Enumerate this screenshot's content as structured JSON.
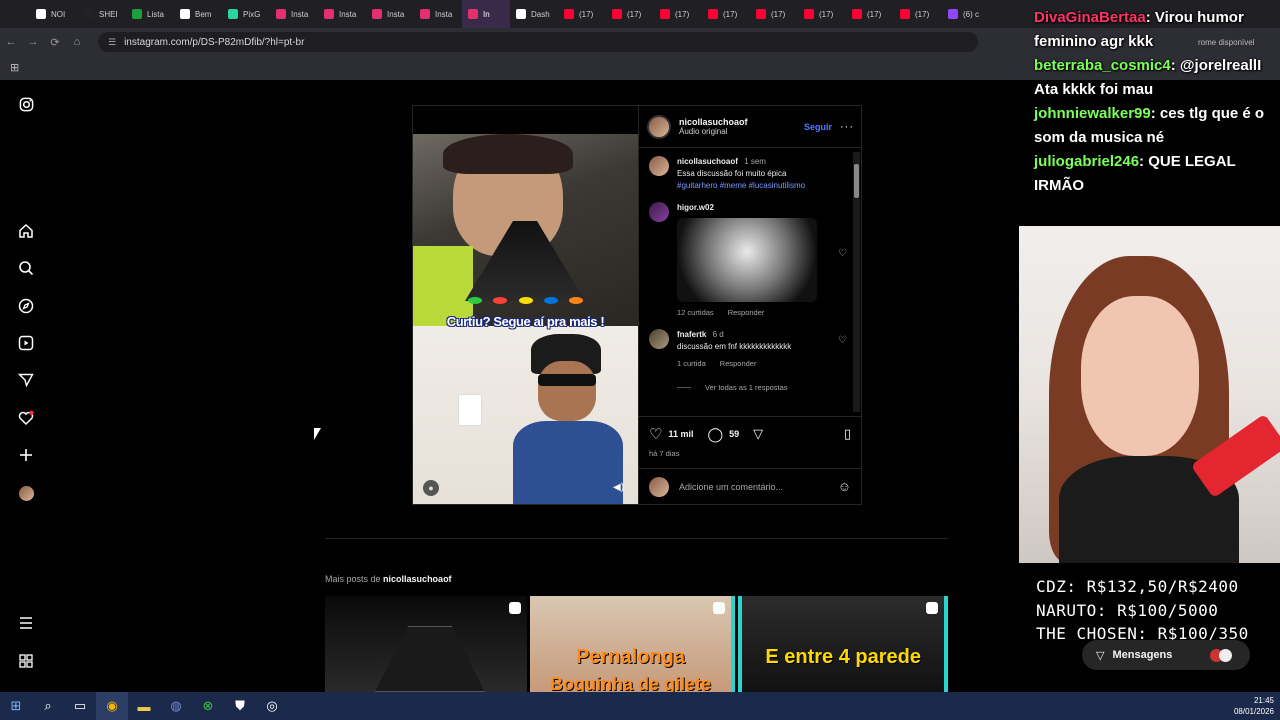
{
  "browser": {
    "tabs": [
      {
        "label": "NOI",
        "color": "#ffffff"
      },
      {
        "label": "SHEI",
        "color": "#222222"
      },
      {
        "label": "Lista",
        "color": "#1e9e3a"
      },
      {
        "label": "Bem",
        "color": "#ffffff"
      },
      {
        "label": "PixG",
        "color": "#2ad49a"
      },
      {
        "label": "Insta",
        "color": "#e1306c"
      },
      {
        "label": "Insta",
        "color": "#e1306c"
      },
      {
        "label": "Insta",
        "color": "#e1306c"
      },
      {
        "label": "Insta",
        "color": "#e1306c"
      },
      {
        "label": "In",
        "color": "#e1306c",
        "active": true
      },
      {
        "label": "Dash",
        "color": "#ffffff"
      },
      {
        "label": "(17)",
        "color": "#ff0033"
      },
      {
        "label": "(17)",
        "color": "#ff0033"
      },
      {
        "label": "(17)",
        "color": "#ff0033"
      },
      {
        "label": "(17)",
        "color": "#ff0033"
      },
      {
        "label": "(17)",
        "color": "#ff0033"
      },
      {
        "label": "(17)",
        "color": "#ff0033"
      },
      {
        "label": "(17)",
        "color": "#ff0033"
      },
      {
        "label": "(17)",
        "color": "#ff0033"
      },
      {
        "label": "(6) c",
        "color": "#9146ff"
      }
    ],
    "url": "instagram.com/p/DS-P82mDfib/?hl=pt-br",
    "update_text": "rome disponível"
  },
  "post": {
    "author": "nicollasuchoaof",
    "audio": "Áudio original",
    "follow_label": "Seguir",
    "overlay_caption": "Curtiu? Segue aí pra mais !",
    "caption": {
      "user": "nicollasuchoaof",
      "time": "1 sem",
      "text": "Essa discussão foi muito épica",
      "tags": "#guitarhero #meme #lucasinutilismo"
    },
    "comments": [
      {
        "user": "higor.w02",
        "likes": "12 curtidas",
        "reply": "Responder"
      },
      {
        "user": "fnafertk",
        "time": "6 d",
        "text": "discussão em fnf kkkkkkkkkkkkk",
        "likes": "1 curtida",
        "reply": "Responder",
        "replies": "Ver todas as 1 respostas"
      }
    ],
    "like_count": "11 mil",
    "comment_count": "59",
    "posted_ago": "há 7 dias",
    "add_comment_placeholder": "Adicione um comentário..."
  },
  "more_posts": {
    "label": "Mais posts de",
    "user": "nicollasuchoaof",
    "thumbs": [
      {
        "caption": ""
      },
      {
        "caption": "Pernalonga",
        "caption2": "Boquinha de gilete"
      },
      {
        "caption": "E entre 4 parede"
      }
    ]
  },
  "stream": {
    "chat": [
      {
        "name": "DivaGinaBertaa",
        "msg": ": Virou humor feminino agr kkk",
        "pink": true
      },
      {
        "name": "beterraba_cosmic4",
        "msg": ": @jorelreallI Ata kkkk foi mau"
      },
      {
        "name": "johnniewalker99",
        "msg": ": ces tlg que é o som da musica né"
      },
      {
        "name": "juliogabriel246",
        "msg": ": QUE LEGAL IRMÃO"
      }
    ],
    "goals": [
      "CDZ: R$132,50/R$2400",
      "NARUTO: R$100/5000",
      "THE CHOSEN: R$100/350"
    ],
    "messages_label": "Mensagens"
  },
  "taskbar": {
    "time": "21:45",
    "date": "08/01/2026"
  }
}
